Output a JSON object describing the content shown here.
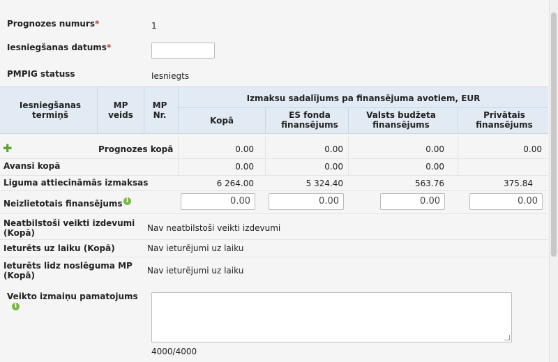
{
  "form": {
    "forecast_number_label": "Prognozes numurs",
    "forecast_number_value": "1",
    "submission_date_label": "Iesniegšanas datums",
    "submission_date_value": "",
    "required_mark": "*",
    "status_label": "PMPIG statuss",
    "status_value": "Iesniegts"
  },
  "table": {
    "headers": {
      "deadline": "Iesniegšanas termiņš",
      "mp_type": "MP veids",
      "mp_nr": "MP Nr.",
      "group": "Izmaksu sadalījums pa finansējuma avotiem, EUR",
      "total": "Kopā",
      "esf": "ES fonda finansējums",
      "state": "Valsts budžeta finansējums",
      "private": "Privātais finansējums"
    },
    "rows": {
      "forecast_total": {
        "label": "Prognozes kopā",
        "values": [
          "0.00",
          "0.00",
          "0.00",
          "0.00"
        ]
      },
      "advance_total": {
        "label": "Avansi kopā",
        "values": [
          "0.00",
          "0.00",
          "0.00"
        ]
      },
      "eligible_costs": {
        "label": "Liguma attiecināmās izmaksas",
        "values": [
          "6 264.00",
          "5 324.40",
          "563.76",
          "375.84"
        ]
      },
      "unused_financing": {
        "label": "Neizlietotais finansējums",
        "values": [
          "0.00",
          "0.00",
          "0.00",
          "0.00"
        ]
      }
    }
  },
  "details": {
    "nonconforming_label": "Neatbilstoši veikti izdevumi (Kopā)",
    "nonconforming_value": "Nav neatbilstoši veikti izdevumi",
    "withheld_time_label": "Ieturēts uz laiku (Kopā)",
    "withheld_time_value": "Nav ieturējumi uz laiku",
    "withheld_end_label": "Ieturēts lidz noslēguma MP (Kopā)",
    "withheld_end_value": "Nav ieturējumi uz laiku",
    "justification_label": "Veikto izmaiņu pamatojums",
    "justification_value": "",
    "char_counter": "4000/4000"
  },
  "icons": {
    "info": "info-icon",
    "add": "plus-icon"
  },
  "colors": {
    "header_bg": "#e2ebf4",
    "required": "#c0392b",
    "icon_green": "#7ab648"
  }
}
